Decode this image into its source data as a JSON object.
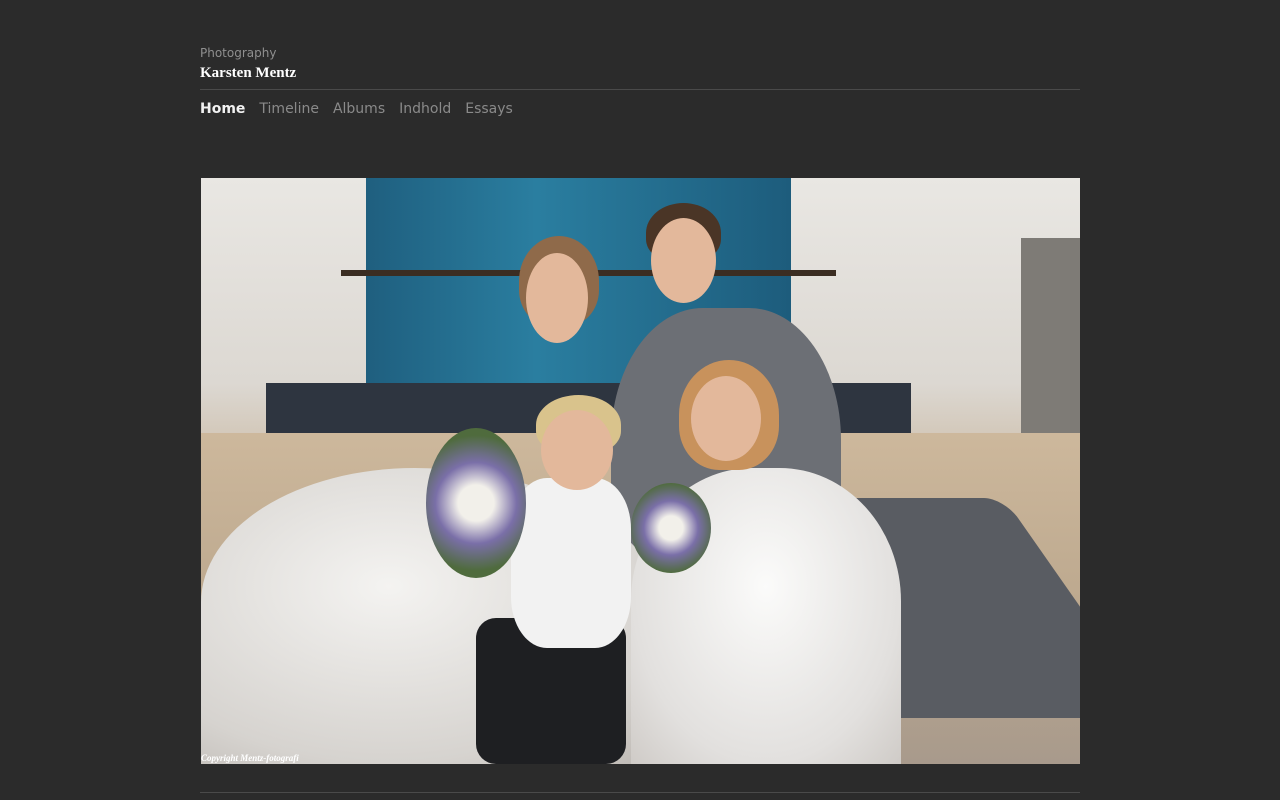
{
  "header": {
    "subtitle": "Photography",
    "title": "Karsten Mentz"
  },
  "nav": {
    "items": [
      {
        "label": "Home",
        "active": true
      },
      {
        "label": "Timeline",
        "active": false
      },
      {
        "label": "Albums",
        "active": false
      },
      {
        "label": "Indhold",
        "active": false
      },
      {
        "label": "Essays",
        "active": false
      }
    ]
  },
  "photo": {
    "watermark": "Copyright Mentz-fotografi"
  },
  "colors": {
    "background": "#2b2b2b",
    "nav_active": "#f2f2f2",
    "nav_inactive": "#8a8a8a"
  }
}
